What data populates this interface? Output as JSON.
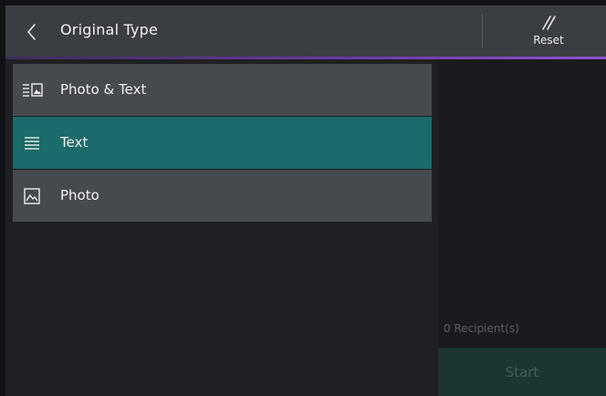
{
  "header": {
    "title": "Original Type",
    "back_icon": "chevron-left-icon",
    "reset_label": "Reset",
    "reset_icon": "double-slash-reset-icon"
  },
  "options": [
    {
      "label": "Photo & Text",
      "icon": "photo-text-icon",
      "selected": false
    },
    {
      "label": "Text",
      "icon": "text-lines-icon",
      "selected": true
    },
    {
      "label": "Photo",
      "icon": "photo-icon",
      "selected": false
    }
  ],
  "panel": {
    "recipients_text": "0 Recipient(s)",
    "start_label": "Start",
    "start_enabled": false
  },
  "colors": {
    "header_bg": "#3a3d42",
    "accent_purple": "#6a3aa3",
    "selected_teal": "#1a6b69",
    "item_bg": "#46494e",
    "background": "#1f2023"
  }
}
